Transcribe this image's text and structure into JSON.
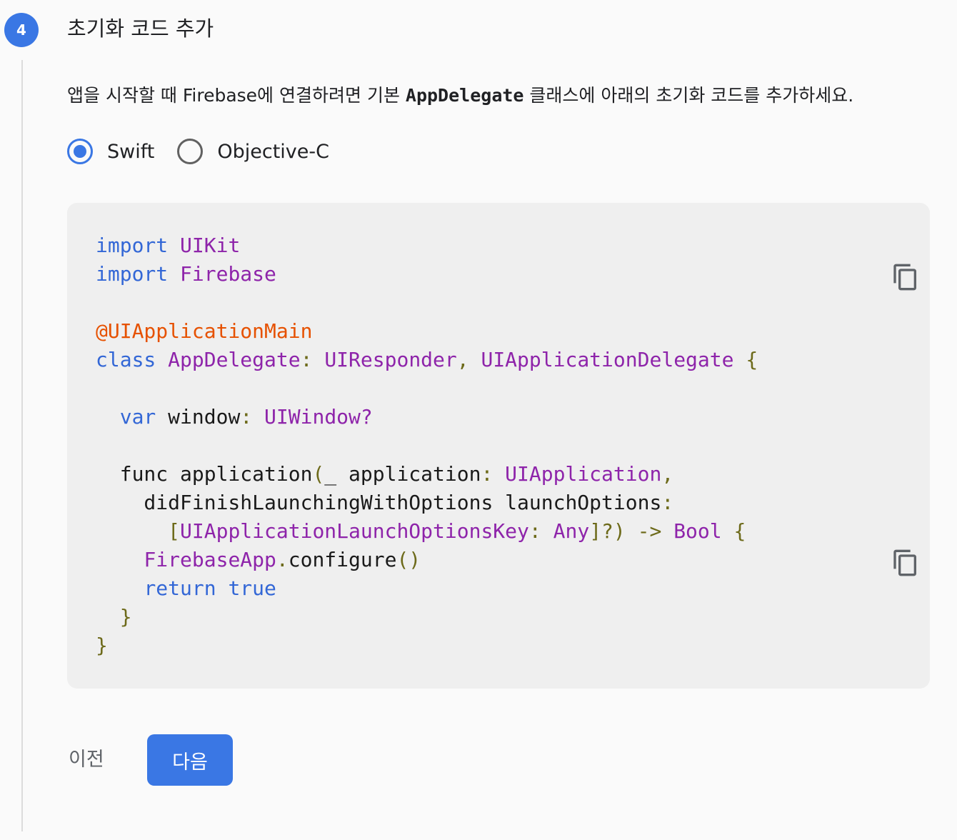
{
  "step": {
    "number": "4",
    "title": "초기화 코드 추가",
    "description_before": "앱을 시작할 때 Firebase에 연결하려면 기본 ",
    "description_code": "AppDelegate",
    "description_after": " 클래스에 아래의 초기화 코드를 추가하세요."
  },
  "language_options": [
    {
      "label": "Swift",
      "selected": true
    },
    {
      "label": "Objective-C",
      "selected": false
    }
  ],
  "code": {
    "language": "Swift",
    "lines": [
      [
        {
          "t": "kw",
          "s": "import "
        },
        {
          "t": "ty",
          "s": "UIKit"
        }
      ],
      [
        {
          "t": "kw",
          "s": "import "
        },
        {
          "t": "ty",
          "s": "Firebase"
        }
      ],
      [],
      [
        {
          "t": "at",
          "s": "@UIApplicationMain"
        }
      ],
      [
        {
          "t": "kw",
          "s": "class "
        },
        {
          "t": "ty",
          "s": "AppDelegate"
        },
        {
          "t": "pu",
          "s": ": "
        },
        {
          "t": "ty",
          "s": "UIResponder"
        },
        {
          "t": "pu",
          "s": ", "
        },
        {
          "t": "ty",
          "s": "UIApplicationDelegate"
        },
        {
          "t": "pu",
          "s": " {"
        }
      ],
      [],
      [
        {
          "t": "tx",
          "s": "  "
        },
        {
          "t": "kw",
          "s": "var "
        },
        {
          "t": "tx",
          "s": "window"
        },
        {
          "t": "pu",
          "s": ": "
        },
        {
          "t": "ty",
          "s": "UIWindow?"
        }
      ],
      [],
      [
        {
          "t": "tx",
          "s": "  func application"
        },
        {
          "t": "pu",
          "s": "("
        },
        {
          "t": "tx",
          "s": "_ application"
        },
        {
          "t": "pu",
          "s": ": "
        },
        {
          "t": "ty",
          "s": "UIApplication"
        },
        {
          "t": "pu",
          "s": ","
        }
      ],
      [
        {
          "t": "tx",
          "s": "    didFinishLaunchingWithOptions launchOptions"
        },
        {
          "t": "pu",
          "s": ":"
        }
      ],
      [
        {
          "t": "tx",
          "s": "      "
        },
        {
          "t": "pu",
          "s": "["
        },
        {
          "t": "ty",
          "s": "UIApplicationLaunchOptionsKey"
        },
        {
          "t": "pu",
          "s": ": "
        },
        {
          "t": "ty",
          "s": "Any"
        },
        {
          "t": "pu",
          "s": "]?) -> "
        },
        {
          "t": "ty",
          "s": "Bool"
        },
        {
          "t": "pu",
          "s": " {"
        }
      ],
      [
        {
          "t": "tx",
          "s": "    "
        },
        {
          "t": "ty",
          "s": "FirebaseApp"
        },
        {
          "t": "pu",
          "s": "."
        },
        {
          "t": "tx",
          "s": "configure"
        },
        {
          "t": "pu",
          "s": "()"
        }
      ],
      [
        {
          "t": "tx",
          "s": "    "
        },
        {
          "t": "kw",
          "s": "return true"
        }
      ],
      [
        {
          "t": "tx",
          "s": "  "
        },
        {
          "t": "pu",
          "s": "}"
        }
      ],
      [
        {
          "t": "pu",
          "s": "}"
        }
      ]
    ]
  },
  "icons": {
    "copy": "copy-icon"
  },
  "buttons": {
    "prev_label": "이전",
    "next_label": "다음"
  },
  "colors": {
    "accent": "#3a77e4",
    "code_background": "#efefef",
    "keyword": "#3367d6",
    "type": "#8e24aa",
    "attribute": "#e65100",
    "punctuation": "#6d6a1a"
  }
}
